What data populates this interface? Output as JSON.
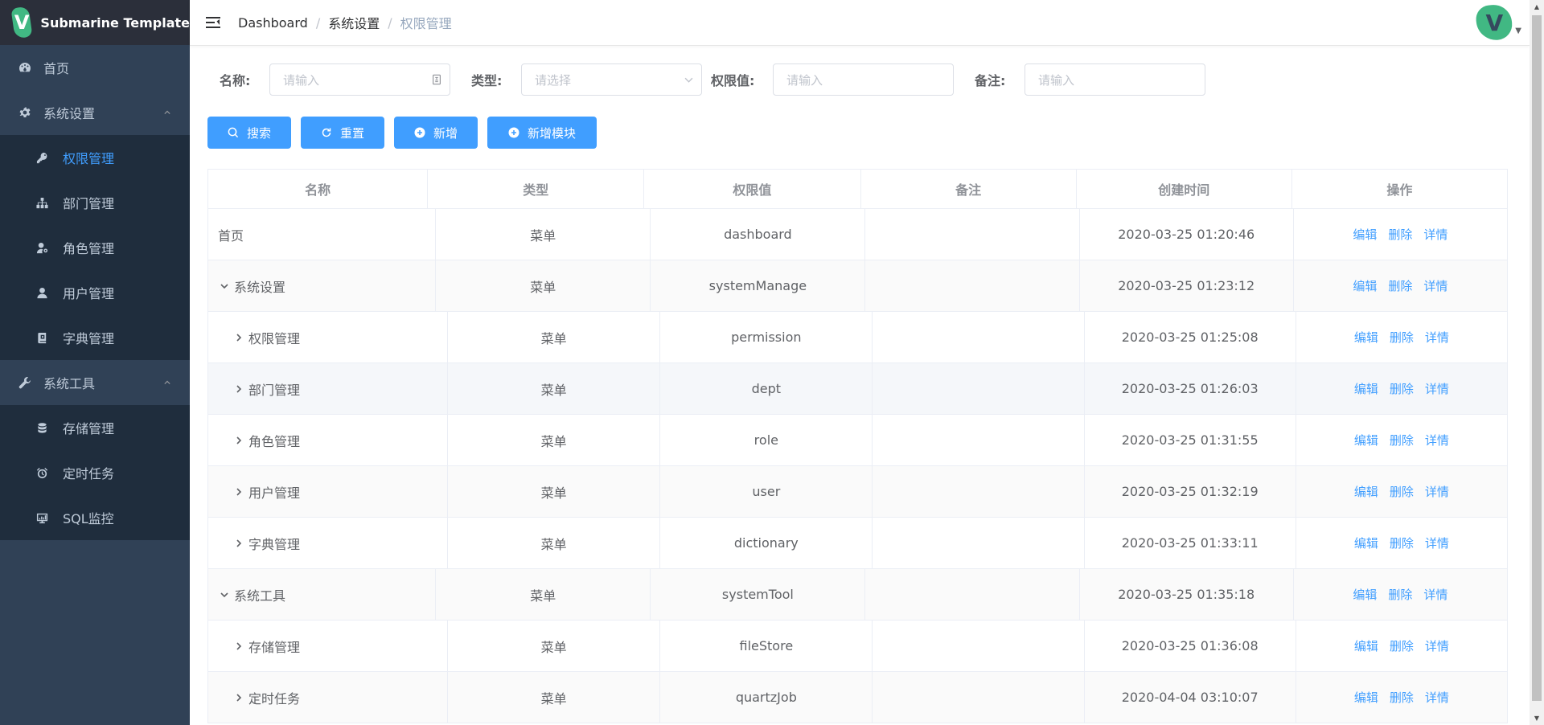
{
  "brand": {
    "title": "Submarine Template",
    "logo_letter": "V"
  },
  "sidebar": {
    "home": "首页",
    "groups": [
      {
        "label": "系统设置",
        "items": [
          "权限管理",
          "部门管理",
          "角色管理",
          "用户管理",
          "字典管理"
        ]
      },
      {
        "label": "系统工具",
        "items": [
          "存储管理",
          "定时任务",
          "SQL监控"
        ]
      }
    ],
    "active_item": "权限管理"
  },
  "navbar": {
    "breadcrumb": [
      "Dashboard",
      "系统设置",
      "权限管理"
    ],
    "avatar_letter": "V"
  },
  "search": {
    "name_label": "名称:",
    "name_placeholder": "请输入",
    "type_label": "类型:",
    "type_placeholder": "请选择",
    "perm_label": "权限值:",
    "perm_placeholder": "请输入",
    "remark_label": "备注:",
    "remark_placeholder": "请输入"
  },
  "buttons": {
    "search": "搜索",
    "reset": "重置",
    "add": "新增",
    "add_module": "新增模块"
  },
  "table": {
    "headers": [
      "名称",
      "类型",
      "权限值",
      "备注",
      "创建时间",
      "操作"
    ],
    "actions": [
      "编辑",
      "删除",
      "详情"
    ],
    "rows": [
      {
        "name": "首页",
        "type": "菜单",
        "perm": "dashboard",
        "remark": "",
        "created": "2020-03-25 01:20:46"
      },
      {
        "name": "系统设置",
        "type": "菜单",
        "perm": "systemManage",
        "remark": "",
        "created": "2020-03-25 01:23:12"
      },
      {
        "name": "权限管理",
        "type": "菜单",
        "perm": "permission",
        "remark": "",
        "created": "2020-03-25 01:25:08"
      },
      {
        "name": "部门管理",
        "type": "菜单",
        "perm": "dept",
        "remark": "",
        "created": "2020-03-25 01:26:03"
      },
      {
        "name": "角色管理",
        "type": "菜单",
        "perm": "role",
        "remark": "",
        "created": "2020-03-25 01:31:55"
      },
      {
        "name": "用户管理",
        "type": "菜单",
        "perm": "user",
        "remark": "",
        "created": "2020-03-25 01:32:19"
      },
      {
        "name": "字典管理",
        "type": "菜单",
        "perm": "dictionary",
        "remark": "",
        "created": "2020-03-25 01:33:11"
      },
      {
        "name": "系统工具",
        "type": "菜单",
        "perm": "systemTool",
        "remark": "",
        "created": "2020-03-25 01:35:18"
      },
      {
        "name": "存储管理",
        "type": "菜单",
        "perm": "fileStore",
        "remark": "",
        "created": "2020-03-25 01:36:08"
      },
      {
        "name": "定时任务",
        "type": "菜单",
        "perm": "quartzJob",
        "remark": "",
        "created": "2020-04-04 03:10:07"
      }
    ]
  },
  "colors": {
    "sidebar_bg": "#304156",
    "submenu_bg": "#1f2d3d",
    "accent": "#409eff",
    "logo_green": "#41b883"
  }
}
